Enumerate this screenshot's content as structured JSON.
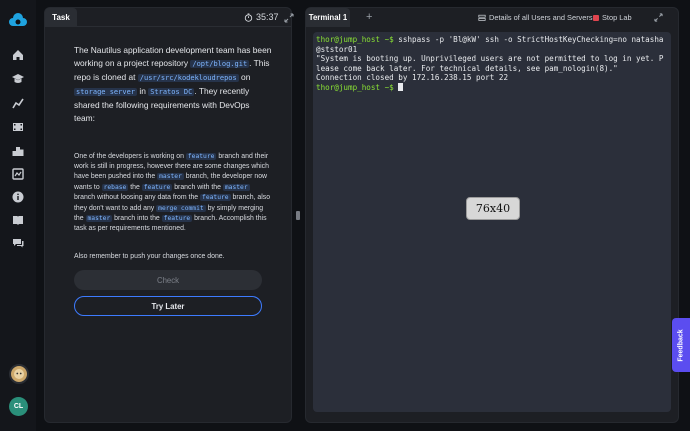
{
  "colors": {
    "accent": "#3d7bff",
    "stop": "#e0454f",
    "feedback": "#5b4df0",
    "prompt": "#8ae234"
  },
  "rail": {
    "items": [
      "home-icon",
      "graduation-cap-icon",
      "chart-line-icon",
      "film-icon",
      "podium-icon",
      "dashboard-icon",
      "info-icon",
      "book-icon",
      "chat-icon"
    ],
    "initials": "CL"
  },
  "task": {
    "tab_label": "Task",
    "timer": "35:37",
    "intro": {
      "t1": "The Nautilus application development team has been working on a project repository ",
      "c1": "/opt/blog.git",
      "t2": ". This repo is cloned at ",
      "c2": "/usr/src/kodekloudrepos",
      "t3": " on ",
      "c3": "storage server",
      "t4": " in ",
      "c4": "Stratos DC",
      "t5": ". They recently shared the following requirements with DevOps team:"
    },
    "details": {
      "t1": "One of the developers is working on ",
      "c1": "feature",
      "t2": " branch and their work is still in progress, however there are some changes which have been pushed into the ",
      "c2": "master",
      "t3": " branch, the developer now wants to ",
      "c3": "rebase",
      "t4": " the ",
      "c4": "feature",
      "t5": " branch with the ",
      "c5": "master",
      "t6": " branch without loosing any data from the ",
      "c6": "feature",
      "t7": " branch, also they don't want to add any ",
      "c7": "merge commit",
      "t8": " by simply merging the ",
      "c8": "master",
      "t9": " branch into the ",
      "c9": "feature",
      "t10": " branch. Accomplish this task as per requirements mentioned."
    },
    "reminder": "Also remember to push your changes once done.",
    "check_label": "Check",
    "try_later_label": "Try Later"
  },
  "terminal": {
    "tab_label": "Terminal 1",
    "add_tab": "+",
    "details_link": "Details of all Users and Servers",
    "stop_label": "Stop Lab",
    "prompt1": "thor@jump_host ~$",
    "command1": " sshpass -p 'Bl@kW' ssh -o StrictHostKeyChecking=no natasha@ststor01",
    "output1": "\"System is booting up. Unprivileged users are not permitted to log in yet. Please come back later. For technical details, see pam_nologin(8).\"",
    "output2": "Connection closed by 172.16.238.15 port 22",
    "prompt2": "thor@jump_host ~$",
    "size_badge": "76x40"
  },
  "feedback_label": "Feedback"
}
